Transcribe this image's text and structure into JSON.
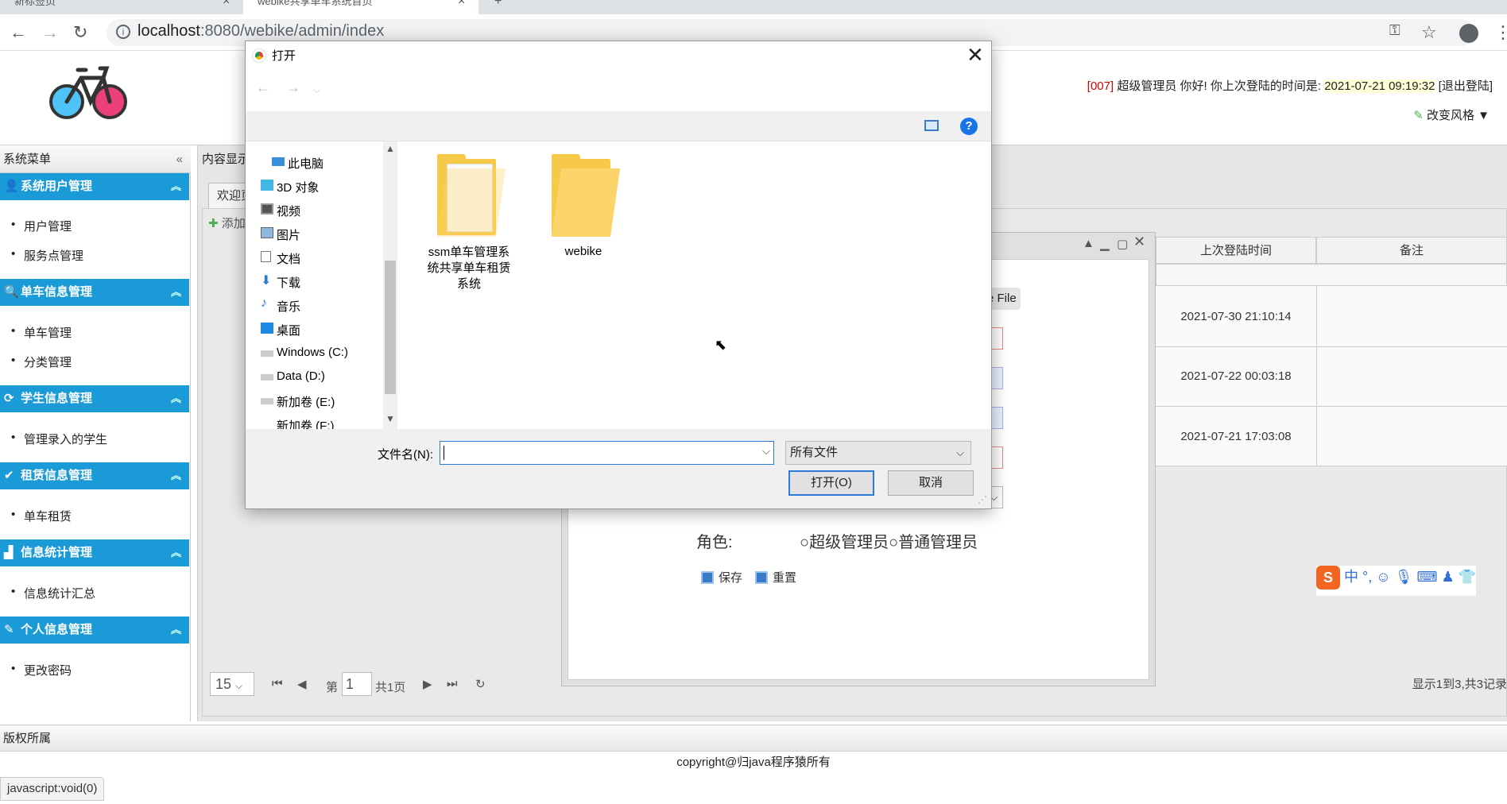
{
  "browser": {
    "tabs": [
      {
        "label": "新标签页"
      },
      {
        "label": "webike共享单车系统首页"
      }
    ],
    "new_tab": "+",
    "url_host": "localhost",
    "url_path": ":8080/webike/admin/index"
  },
  "header": {
    "user_id": "[007]",
    "welcome_text": "超级管理员 你好! 你上次登陆的时间是:",
    "last_login": "2021-07-21 09:19:32",
    "logout": "[退出登陆]",
    "style_button": "改变风格"
  },
  "sidebar": {
    "title": "系统菜单",
    "categories": [
      {
        "label": "系统用户管理",
        "items": [
          "用户管理",
          "服务点管理"
        ]
      },
      {
        "label": "单车信息管理",
        "items": [
          "单车管理",
          "分类管理"
        ]
      },
      {
        "label": "学生信息管理",
        "items": [
          "管理录入的学生"
        ]
      },
      {
        "label": "租赁信息管理",
        "items": [
          "单车租赁"
        ]
      },
      {
        "label": "信息统计管理",
        "items": [
          "信息统计汇总"
        ]
      },
      {
        "label": "个人信息管理",
        "items": [
          "更改密码"
        ]
      }
    ]
  },
  "content": {
    "title": "内容显示",
    "tab": "欢迎页",
    "add_button": "添加",
    "columns": [
      "上次登陆时间",
      "备注"
    ],
    "rows": [
      {
        "last_login": "2021-07-30 21:10:14",
        "note": ""
      },
      {
        "last_login": "2021-07-22 00:03:18",
        "note": ""
      },
      {
        "last_login": "2021-07-21 17:03:08",
        "note": ""
      }
    ],
    "pager": {
      "page_size": "15",
      "page_prefix": "第",
      "page": "1",
      "page_total": "共1页"
    },
    "show_info": "显示1到3,共3记录"
  },
  "modal": {
    "choose_file_fragment": "e File",
    "role_label": "角色:",
    "role_options": [
      "超级管理员",
      "普通管理员"
    ],
    "save": "保存",
    "reset": "重置"
  },
  "file_dialog": {
    "title": "打开",
    "nav": [
      {
        "label": "此电脑",
        "icon": "computer-icon"
      },
      {
        "label": "3D 对象",
        "icon": "cube-icon"
      },
      {
        "label": "视频",
        "icon": "video-icon"
      },
      {
        "label": "图片",
        "icon": "picture-icon"
      },
      {
        "label": "文档",
        "icon": "document-icon"
      },
      {
        "label": "下载",
        "icon": "download-icon"
      },
      {
        "label": "音乐",
        "icon": "music-icon"
      },
      {
        "label": "桌面",
        "icon": "desktop-icon"
      },
      {
        "label": "Windows (C:)",
        "icon": "drive-icon"
      },
      {
        "label": "Data (D:)",
        "icon": "drive-icon"
      },
      {
        "label": "新加卷 (E:)",
        "icon": "drive-icon"
      },
      {
        "label": "新加卷 (F:)",
        "icon": "drive-icon"
      }
    ],
    "folders": [
      {
        "name_line1": "ssm单车管理系",
        "name_line2": "统共享单车租赁",
        "name_line3": "系统"
      },
      {
        "name_line1": "webike",
        "name_line2": "",
        "name_line3": ""
      }
    ],
    "filename_label": "文件名(N):",
    "filename_value": "",
    "filter": "所有文件",
    "open_button": "打开(O)",
    "cancel_button": "取消"
  },
  "footer": {
    "title": "版权所属",
    "copyright": "copyright@归java程序猿所有"
  },
  "status": "javascript:void(0)",
  "colors": {
    "menu_blue": "#1a9bd7",
    "accent_blue": "#2d7ad6"
  }
}
